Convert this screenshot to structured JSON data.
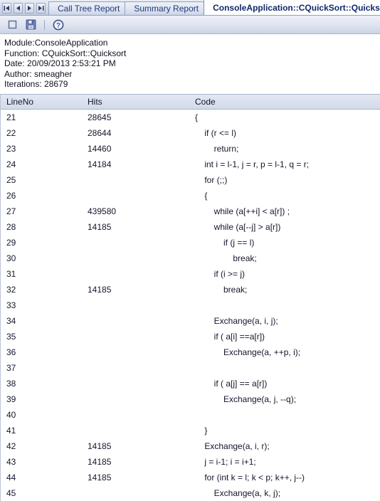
{
  "window": {
    "nav_buttons": [
      {
        "name": "first",
        "label": "|◀"
      },
      {
        "name": "previous",
        "label": "◀"
      },
      {
        "name": "next",
        "label": "▶"
      },
      {
        "name": "last",
        "label": "▶|"
      }
    ],
    "tabs": [
      {
        "label": "Call Tree Report",
        "active": false
      },
      {
        "label": "Summary Report",
        "active": false
      },
      {
        "label": "ConsoleApplication::CQuickSort::Quicksort",
        "active": true
      }
    ]
  },
  "toolbar": {
    "items": [
      {
        "icon": "stop-icon",
        "label": "Stop"
      },
      {
        "icon": "save-icon",
        "label": "Save"
      },
      {
        "icon": "separator",
        "label": ""
      },
      {
        "icon": "help-icon",
        "label": "Help"
      }
    ]
  },
  "info": {
    "module": "Module:ConsoleApplication",
    "function": "Function: CQuickSort::Quicksort",
    "date": "Date: 20/09/2013 2:53:21 PM",
    "author": "Author: smeagher",
    "iterations": "Iterations: 28679"
  },
  "grid": {
    "columns": [
      "LineNo",
      "Hits",
      "Code"
    ],
    "rows": [
      {
        "line": "21",
        "hits": "28645",
        "code": "{"
      },
      {
        "line": "22",
        "hits": "28644",
        "code": "    if (r <= l)"
      },
      {
        "line": "23",
        "hits": "14460",
        "code": "        return;"
      },
      {
        "line": "24",
        "hits": "14184",
        "code": "    int i = l-1, j = r, p = l-1, q = r;"
      },
      {
        "line": "25",
        "hits": "",
        "code": "    for (;;)"
      },
      {
        "line": "26",
        "hits": "",
        "code": "    {"
      },
      {
        "line": "27",
        "hits": "439580",
        "code": "        while (a[++i] < a[r]) ;"
      },
      {
        "line": "28",
        "hits": "14185",
        "code": "        while (a[--j] > a[r])"
      },
      {
        "line": "29",
        "hits": "",
        "code": "            if (j == l)"
      },
      {
        "line": "30",
        "hits": "",
        "code": "                break;"
      },
      {
        "line": "31",
        "hits": "",
        "code": "        if (i >= j)"
      },
      {
        "line": "32",
        "hits": "14185",
        "code": "            break;"
      },
      {
        "line": "33",
        "hits": "",
        "code": ""
      },
      {
        "line": "34",
        "hits": "",
        "code": "        Exchange(a, i, j);"
      },
      {
        "line": "35",
        "hits": "",
        "code": "        if ( a[i] ==a[r])"
      },
      {
        "line": "36",
        "hits": "",
        "code": "            Exchange(a, ++p, i);"
      },
      {
        "line": "37",
        "hits": "",
        "code": ""
      },
      {
        "line": "38",
        "hits": "",
        "code": "        if ( a[j] == a[r])"
      },
      {
        "line": "39",
        "hits": "",
        "code": "            Exchange(a, j, --q);"
      },
      {
        "line": "40",
        "hits": "",
        "code": ""
      },
      {
        "line": "41",
        "hits": "",
        "code": "    }"
      },
      {
        "line": "42",
        "hits": "14185",
        "code": "    Exchange(a, i, r);"
      },
      {
        "line": "43",
        "hits": "14185",
        "code": "    j = i-1; i = i+1;"
      },
      {
        "line": "44",
        "hits": "14185",
        "code": "    for (int k = l; k < p; k++, j--)"
      },
      {
        "line": "45",
        "hits": "",
        "code": "        Exchange(a, k, j);"
      }
    ]
  }
}
